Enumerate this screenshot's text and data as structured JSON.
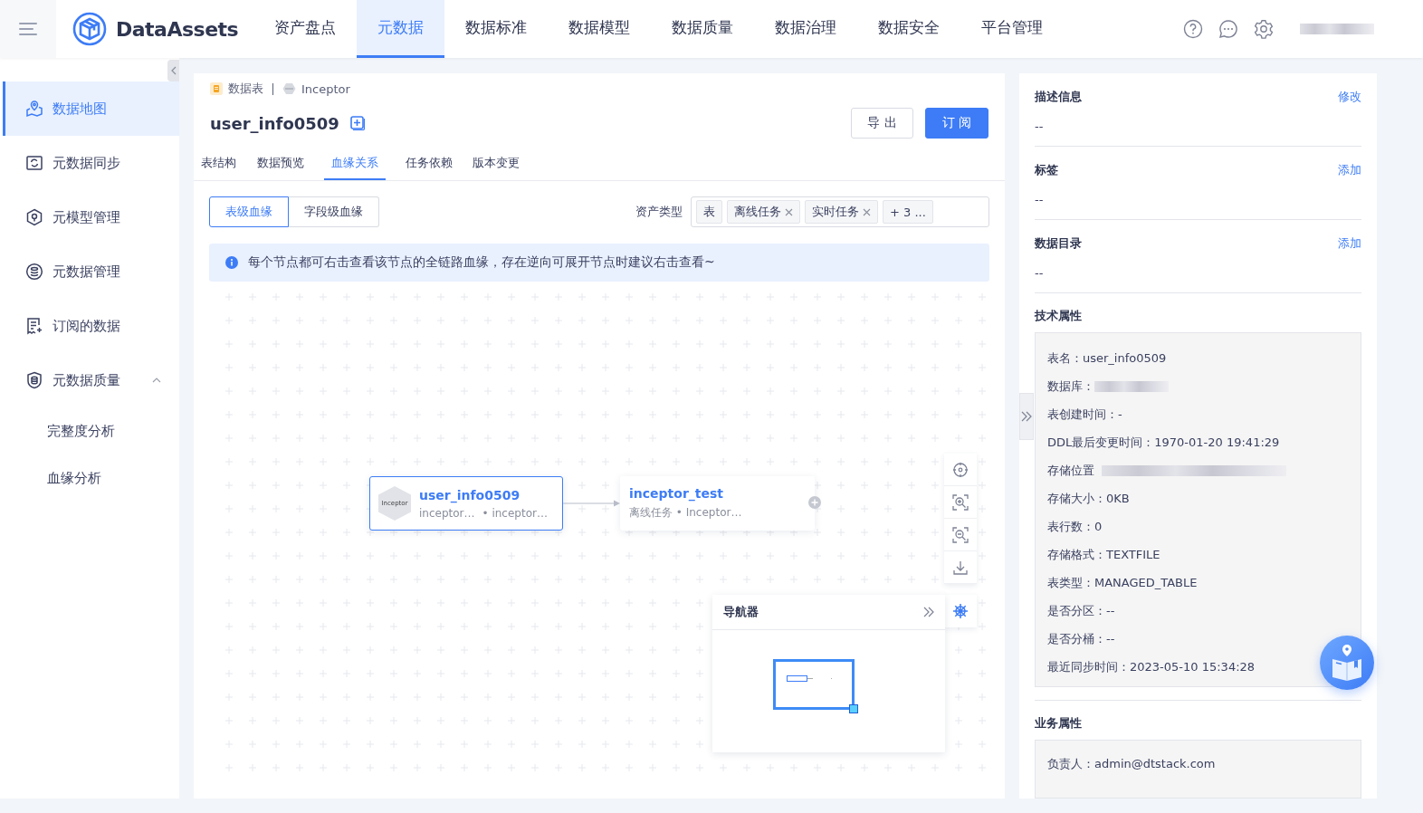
{
  "header": {
    "brand": "DataAssets",
    "nav": [
      {
        "label": "资产盘点",
        "selected": false
      },
      {
        "label": "元数据",
        "selected": true
      },
      {
        "label": "数据标准",
        "selected": false
      },
      {
        "label": "数据模型",
        "selected": false
      },
      {
        "label": "数据质量",
        "selected": false
      },
      {
        "label": "数据治理",
        "selected": false
      },
      {
        "label": "数据安全",
        "selected": false
      },
      {
        "label": "平台管理",
        "selected": false
      }
    ]
  },
  "sidebar": {
    "items": [
      {
        "label": "数据地图",
        "selected": true
      },
      {
        "label": "元数据同步",
        "selected": false
      },
      {
        "label": "元模型管理",
        "selected": false
      },
      {
        "label": "元数据管理",
        "selected": false
      },
      {
        "label": "订阅的数据",
        "selected": false
      },
      {
        "label": "元数据质量",
        "selected": false,
        "expanded": true,
        "children": [
          {
            "label": "完整度分析",
            "selected": false
          },
          {
            "label": "血缘分析",
            "selected": false
          }
        ]
      }
    ]
  },
  "breadcrumb": {
    "type": "数据表",
    "source": "Inceptor"
  },
  "title": "user_info0509",
  "actions": [
    {
      "label": "导 出",
      "kind": "default"
    },
    {
      "label": "订 阅",
      "kind": "primary"
    }
  ],
  "tabs": [
    {
      "label": "表结构",
      "selected": false
    },
    {
      "label": "数据预览",
      "selected": false
    },
    {
      "label": "血缘关系",
      "selected": true
    },
    {
      "label": "任务依赖",
      "selected": false
    },
    {
      "label": "版本变更",
      "selected": false
    }
  ],
  "lineage_modes": [
    {
      "label": "表级血缘",
      "selected": true
    },
    {
      "label": "字段级血缘",
      "selected": false
    }
  ],
  "asset_type": {
    "label": "资产类型",
    "tags": [
      {
        "label": "表",
        "closable": false
      },
      {
        "label": "离线任务",
        "closable": true
      },
      {
        "label": "实时任务",
        "closable": true
      },
      {
        "label": "+ 3 ...",
        "closable": false
      }
    ]
  },
  "notice": "每个节点都可右击查看该节点的全链路血缘，存在逆向可展开节点时建议右击查看~",
  "graph": {
    "nodes": [
      {
        "title": "user_info0509",
        "badge": "Inceptor",
        "meta_1": "inceptor…",
        "meta_2": "• inceptor…",
        "selected": true,
        "expandable": false
      },
      {
        "title": "inceptor_test",
        "meta_1": "离线任务 • Inceptor…",
        "selected": false,
        "expandable": true
      }
    ],
    "navigator": {
      "title": "导航器"
    }
  },
  "details": {
    "sections": [
      {
        "title": "描述信息",
        "action": "修改",
        "value": "--"
      },
      {
        "title": "标签",
        "action": "添加",
        "value": "--"
      },
      {
        "title": "数据目录",
        "action": "添加",
        "value": "--"
      }
    ],
    "tech": {
      "title": "技术属性",
      "props": [
        {
          "kind": "text",
          "text": "表名：user_info0509"
        },
        {
          "kind": "redacted",
          "text": "数据库："
        },
        {
          "kind": "text",
          "text": "表创建时间：-"
        },
        {
          "kind": "text",
          "text": "DDL最后变更时间：1970-01-20 19:41:29"
        },
        {
          "kind": "redacted",
          "text": "存储位置"
        },
        {
          "kind": "text",
          "text": "存储大小：0KB"
        },
        {
          "kind": "text",
          "text": "表行数：0"
        },
        {
          "kind": "text",
          "text": "存储格式：TEXTFILE"
        },
        {
          "kind": "text",
          "text": "表类型：MANAGED_TABLE"
        },
        {
          "kind": "text",
          "text": "是否分区：--"
        },
        {
          "kind": "text",
          "text": "是否分桶：--"
        },
        {
          "kind": "text",
          "text": "最近同步时间：2023-05-10 15:34:28"
        }
      ]
    },
    "business": {
      "title": "业务属性",
      "props": [
        {
          "text": "负责人：admin@dtstack.com"
        }
      ]
    }
  }
}
